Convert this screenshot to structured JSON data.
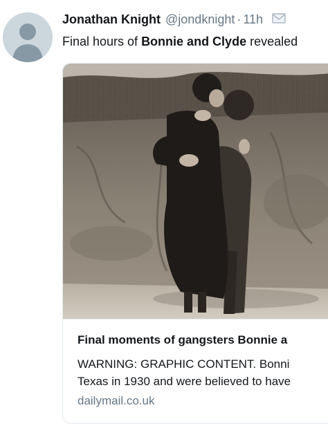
{
  "tweet": {
    "display_name": "Jonathan Knight",
    "handle": "@jondknight",
    "separator": "·",
    "time": "11h",
    "text_prefix": "Final hours of ",
    "text_bold": "Bonnie and Clyde",
    "text_suffix": " revealed"
  },
  "icons": {
    "avatar": "default-profile-avatar",
    "direct_message": "envelope-icon"
  },
  "card": {
    "photo_alt": "Black and white photograph of a couple embracing and kissing in front of an earthen bank",
    "title": "Final moments of gangsters Bonnie a",
    "description_line_1": "WARNING: GRAPHIC CONTENT. Bonni",
    "description_line_2": "Texas in 1930 and were believed to have",
    "domain": "dailymail.co.uk"
  },
  "colors": {
    "text_primary": "#14171a",
    "text_secondary": "#657786",
    "border": "#e1e8ed",
    "avatar_bg": "#ccd6dd",
    "avatar_fg": "#8899a6"
  }
}
